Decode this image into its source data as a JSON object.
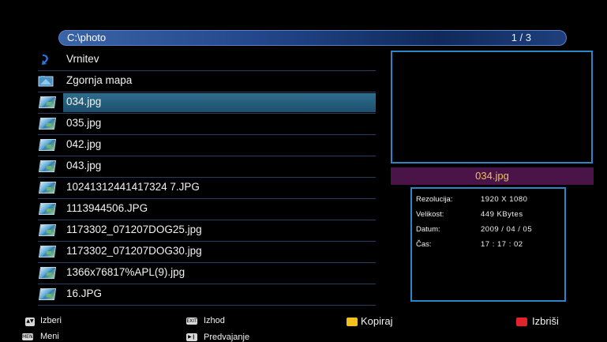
{
  "path_bar": {
    "path": "C:\\photo",
    "page": "1 / 3"
  },
  "files": [
    {
      "name": "Vrnitev",
      "icon": "return-arrow-icon"
    },
    {
      "name": "Zgornja mapa",
      "icon": "up-folder-icon"
    },
    {
      "name": "034.jpg",
      "icon": "image-file-icon",
      "selected": true
    },
    {
      "name": "035.jpg",
      "icon": "image-file-icon"
    },
    {
      "name": "042.jpg",
      "icon": "image-file-icon"
    },
    {
      "name": "043.jpg",
      "icon": "image-file-icon"
    },
    {
      "name": "10241312441417324 7.JPG",
      "icon": "image-file-icon"
    },
    {
      "name": "1113944506.JPG",
      "icon": "image-file-icon"
    },
    {
      "name": "1173302_071207DOG25.jpg",
      "icon": "image-file-icon"
    },
    {
      "name": "1173302_071207DOG30.jpg",
      "icon": "image-file-icon"
    },
    {
      "name": "1366x76817%APL(9).jpg",
      "icon": "image-file-icon"
    },
    {
      "name": "16.JPG",
      "icon": "image-file-icon"
    }
  ],
  "selected_file": "034.jpg",
  "info": {
    "resolution_label": "Rezolucija:",
    "resolution": "1920 X 1080",
    "size_label": "Velikost:",
    "size": "449 KBytes",
    "date_label": "Datum:",
    "date": "2009 / 04 / 05",
    "time_label": "Čas:",
    "time": "17 : 17 : 02"
  },
  "help": {
    "select": "Izberi",
    "menu_key": "MENU",
    "menu": "Meni",
    "exit_key": "EXIT",
    "exit": "Izhod",
    "play": "Predvajanje",
    "copy": "Kopiraj",
    "delete": "Izbriši"
  },
  "colors": {
    "accent_border": "#2a86c6",
    "filename_bar": "#4b1449",
    "filename_text": "#f0c15a"
  }
}
